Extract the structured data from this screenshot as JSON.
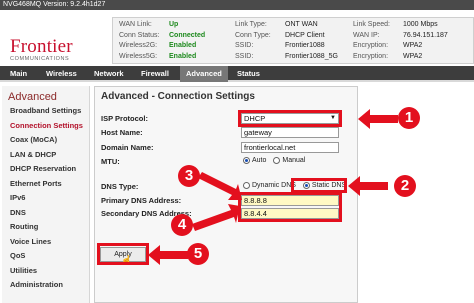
{
  "topbar": {
    "version": "NVG468MQ Version: 9.2.4h1d27"
  },
  "brand": {
    "name": "Frontier",
    "tagline": "COMMUNICATIONS"
  },
  "status": {
    "col1": [
      {
        "label": "WAN Link:",
        "value": "Up",
        "ok": true
      },
      {
        "label": "Conn Status:",
        "value": "Connected",
        "ok": true
      },
      {
        "label": "Wireless2G:",
        "value": "Enabled",
        "ok": true
      },
      {
        "label": "Wireless5G:",
        "value": "Enabled",
        "ok": true
      }
    ],
    "col2": [
      {
        "label": "Link Type:",
        "value": "ONT WAN"
      },
      {
        "label": "Conn Type:",
        "value": "DHCP Client"
      },
      {
        "label": "SSID:",
        "value": "Frontier1088"
      },
      {
        "label": "SSID:",
        "value": "Frontier1088_5G"
      }
    ],
    "col3": [
      {
        "label": "Link Speed:",
        "value": "1000 Mbps"
      },
      {
        "label": "WAN IP:",
        "value": "76.94.151.187"
      },
      {
        "label": "Encryption:",
        "value": "WPA2"
      },
      {
        "label": "Encryption:",
        "value": "WPA2"
      }
    ]
  },
  "nav": [
    "Main",
    "Wireless",
    "Network",
    "Firewall",
    "Advanced",
    "Status"
  ],
  "nav_active": "Advanced",
  "sidebar": {
    "title": "Advanced",
    "items": [
      "Broadband Settings",
      "Connection Settings",
      "Coax (MoCA)",
      "LAN & DHCP",
      "DHCP Reservation",
      "Ethernet Ports",
      "IPv6",
      "DNS",
      "Routing",
      "Voice Lines",
      "QoS",
      "Utilities",
      "Administration"
    ],
    "active": "Connection Settings"
  },
  "form": {
    "title": "Advanced - Connection Settings",
    "isp_protocol_label": "ISP Protocol:",
    "isp_protocol_value": "DHCP",
    "host_name_label": "Host Name:",
    "host_name_value": "gateway",
    "domain_name_label": "Domain Name:",
    "domain_name_value": "frontierlocal.net",
    "mtu_label": "MTU:",
    "mtu_auto": "Auto",
    "mtu_manual": "Manual",
    "dns_type_label": "DNS Type:",
    "dns_dynamic": "Dynamic DNS",
    "dns_static": "Static DNS",
    "primary_dns_label": "Primary DNS Address:",
    "primary_dns_value": "8.8.8.8",
    "secondary_dns_label": "Secondary DNS Address:",
    "secondary_dns_value": "8.8.4.4",
    "apply_label": "Apply"
  },
  "callouts": [
    "1",
    "2",
    "3",
    "4",
    "5"
  ],
  "colors": {
    "brand": "#c8102e",
    "highlight": "#e3101e",
    "nav_bg": "#3d3d3d"
  }
}
